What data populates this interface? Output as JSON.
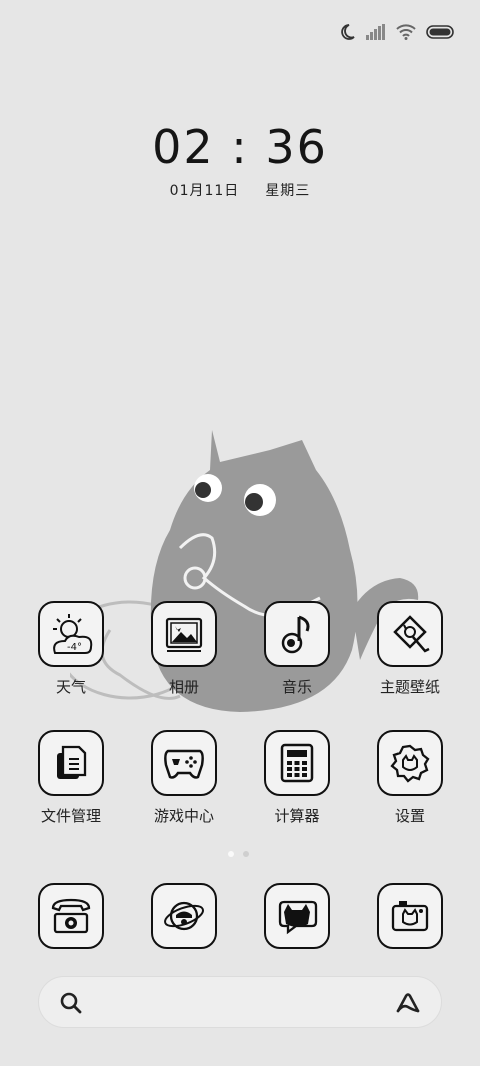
{
  "status_bar": {
    "icons": [
      "moon-icon",
      "signal-icon",
      "wifi-icon",
      "battery-icon"
    ]
  },
  "lockscreen": {
    "time": "02 : 36",
    "date": "01月11日",
    "weekday": "星期三"
  },
  "apps_row1": [
    {
      "label": "天气",
      "icon": "weather-icon",
      "temp": "-4°"
    },
    {
      "label": "相册",
      "icon": "gallery-icon"
    },
    {
      "label": "音乐",
      "icon": "music-icon"
    },
    {
      "label": "主题壁纸",
      "icon": "themes-icon"
    }
  ],
  "apps_row2": [
    {
      "label": "文件管理",
      "icon": "files-icon"
    },
    {
      "label": "游戏中心",
      "icon": "gamepad-icon"
    },
    {
      "label": "计算器",
      "icon": "calculator-icon"
    },
    {
      "label": "设置",
      "icon": "settings-icon"
    }
  ],
  "page_indicator": {
    "pages": 2,
    "current": 1
  },
  "dock": [
    {
      "icon": "phone-icon"
    },
    {
      "icon": "browser-icon"
    },
    {
      "icon": "messages-icon"
    },
    {
      "icon": "camera-icon"
    }
  ],
  "search": {
    "placeholder": "",
    "left_icon": "search-icon",
    "right_icon": "assistant-icon"
  },
  "colors": {
    "background": "#e6e6e6",
    "icon_stroke": "#111111",
    "icon_fill": "#f3f3f3",
    "wallpaper_cat": "#9a9a9a"
  }
}
